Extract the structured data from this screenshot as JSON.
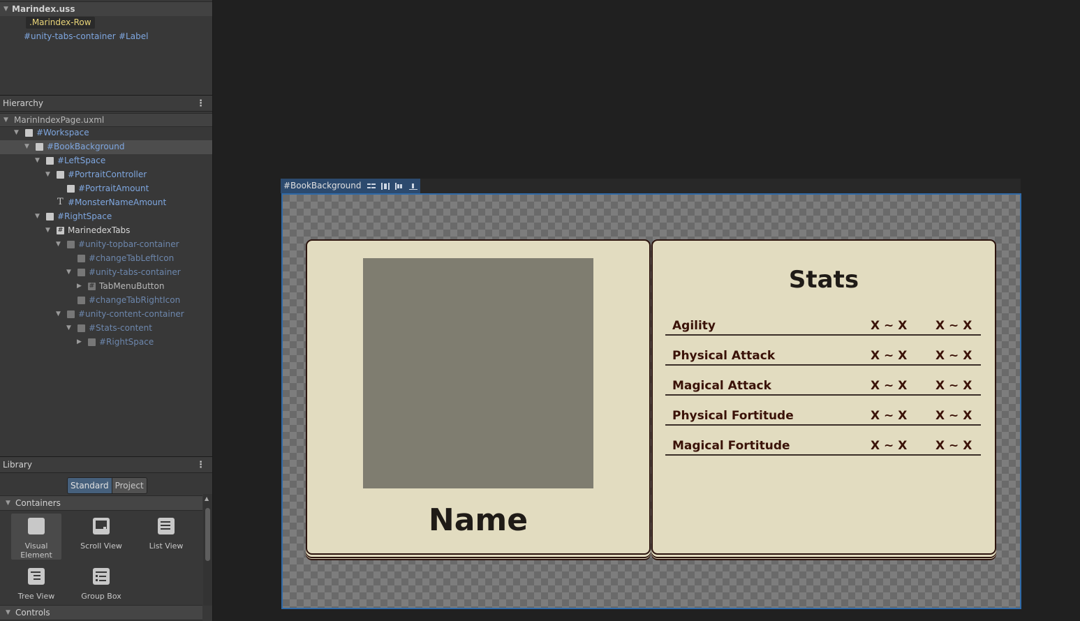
{
  "uss_panel": {
    "title": "Marindex.uss",
    "selector": ".Marindex-Row",
    "selector_parts": [
      "#unity-tabs-container",
      "#Label"
    ]
  },
  "hierarchy": {
    "title": "Hierarchy",
    "menu_glyph": "⋮",
    "file": "MarinIndexPage.uxml",
    "items": [
      {
        "label": "#Workspace"
      },
      {
        "label": "#BookBackground"
      },
      {
        "label": "#LeftSpace"
      },
      {
        "label": "#PortraitController"
      },
      {
        "label": "#PortraitAmount"
      },
      {
        "label": "#MonsterNameAmount"
      },
      {
        "label": "#RightSpace"
      },
      {
        "label": "MarinedexTabs"
      },
      {
        "label": "#unity-topbar-container"
      },
      {
        "label": "#changeTabLeftIcon"
      },
      {
        "label": "#unity-tabs-container"
      },
      {
        "label": "TabMenuButton"
      },
      {
        "label": "#changeTabRightIcon"
      },
      {
        "label": "#unity-content-container"
      },
      {
        "label": "#Stats-content"
      },
      {
        "label": "#RightSpace"
      }
    ]
  },
  "library": {
    "title": "Library",
    "menu_glyph": "⋮",
    "tab_standard": "Standard",
    "tab_project": "Project",
    "category_containers": "Containers",
    "category_controls": "Controls",
    "items": [
      {
        "label": "Visual Element"
      },
      {
        "label": "Scroll View"
      },
      {
        "label": "List View"
      },
      {
        "label": "Tree View"
      },
      {
        "label": "Group Box"
      }
    ]
  },
  "canvas": {
    "element_name": "#BookBackground"
  },
  "book": {
    "name": "Name",
    "stats_title": "Stats",
    "stats": [
      {
        "name": "Agility",
        "v1": "X ~ X",
        "v2": "X ~ X"
      },
      {
        "name": "Physical Attack",
        "v1": "X ~ X",
        "v2": "X ~ X"
      },
      {
        "name": "Magical Attack",
        "v1": "X ~ X",
        "v2": "X ~ X"
      },
      {
        "name": "Physical Fortitude",
        "v1": "X ~ X",
        "v2": "X ~ X"
      },
      {
        "name": "Magical Fortitude",
        "v1": "X ~ X",
        "v2": "X ~ X"
      }
    ]
  },
  "colors": {
    "selection": "#2f6aa8",
    "page": "#e2dcc0",
    "ink": "#3a1208"
  }
}
